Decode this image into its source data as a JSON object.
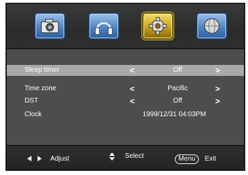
{
  "menu_tabs": [
    {
      "name": "picture-icon",
      "active": false
    },
    {
      "name": "audio-icon",
      "active": false
    },
    {
      "name": "setup-gear-icon",
      "active": true
    },
    {
      "name": "channel-globe-icon",
      "active": false
    }
  ],
  "settings": {
    "sleep_timer": {
      "label": "Sleep timer",
      "value": "Off"
    },
    "time_zone": {
      "label": "Time zone",
      "value": "Pacific"
    },
    "dst": {
      "label": "DST",
      "value": "Off"
    },
    "clock": {
      "label": "Clock",
      "value": "1999/12/31 04:03PM"
    }
  },
  "footer": {
    "adjust_label": "Adjust",
    "select_label": "Select",
    "menu_key": "Menu",
    "exit_label": "Exit"
  }
}
